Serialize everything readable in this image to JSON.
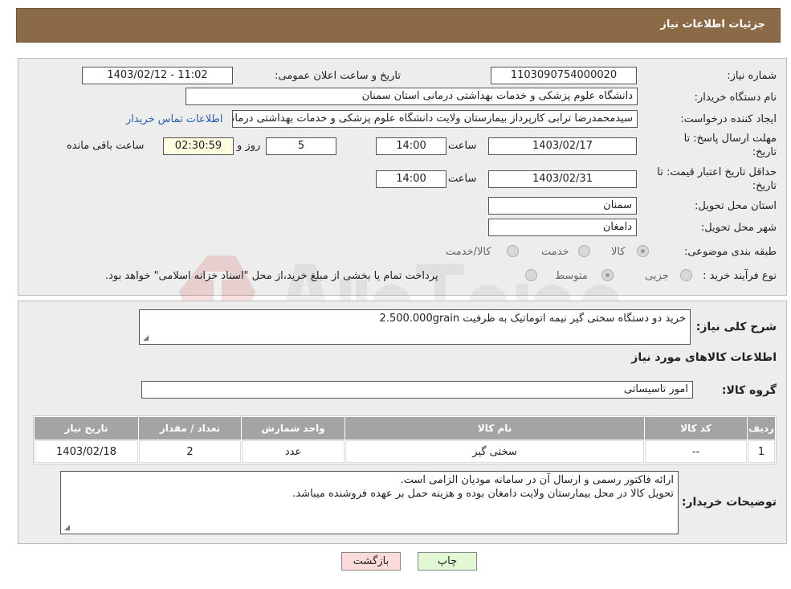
{
  "header": {
    "title": "جزئیات اطلاعات نیاز"
  },
  "form": {
    "need_number": {
      "label": "شماره نیاز:",
      "value": "1103090754000020"
    },
    "announce": {
      "label": "تاریخ و ساعت اعلان عمومی:",
      "value": "1403/02/12 - 11:02"
    },
    "buyer_org": {
      "label": "نام دستگاه خریدار:",
      "value": "دانشگاه علوم پزشکی و خدمات بهداشتی  درمانی استان سمنان"
    },
    "requester": {
      "label": "ایجاد کننده درخواست:",
      "value": "سیدمحمدرضا ترابی کارپرداز بیمارستان ولایت دانشگاه علوم پزشکی و خدمات بهداشتی درمانی",
      "contact_link": "اطلاعات تماس خریدار"
    },
    "reply_deadline": {
      "label_line1": "مهلت ارسال پاسخ: تا",
      "label_line2": "تاریخ:",
      "date": "1403/02/17",
      "time_label": "ساعت",
      "time": "14:00",
      "days": "5",
      "days_label": "روز و",
      "remaining": "02:30:59",
      "remaining_label": "ساعت باقی مانده"
    },
    "price_validity": {
      "label_line1": "حداقل تاریخ اعتبار قیمت: تا",
      "label_line2": "تاریخ:",
      "date": "1403/02/31",
      "time_label": "ساعت",
      "time": "14:00"
    },
    "province": {
      "label": "استان محل تحویل:",
      "value": "سمنان"
    },
    "city": {
      "label": "شهر محل تحویل:",
      "value": "دامغان"
    },
    "category": {
      "label": "طبقه بندی موضوعی:",
      "options": [
        "کالا",
        "خدمت",
        "کالا/خدمت"
      ]
    },
    "purchase_type": {
      "label": "نوع فرآیند خرید :",
      "options": [
        "جزیی",
        "متوسط"
      ],
      "note": "پرداخت تمام یا بخشی از مبلغ خرید،از محل \"اسناد خزانه اسلامی\" خواهد بود."
    }
  },
  "details": {
    "summary_label": "شرح کلی نیاز:",
    "summary": "خرید دو دستگاه سختی گیر نیمه اتوماتیک به ظرفیت 2.500.000grain",
    "goods_heading": "اطلاعات کالاهای مورد نیاز",
    "group_label": "گروه کالا:",
    "group_value": "امور تاسیساتی",
    "table": {
      "headers": [
        "ردیف",
        "کد کالا",
        "نام کالا",
        "واحد شمارش",
        "تعداد / مقدار",
        "تاریخ نیاز"
      ],
      "rows": [
        [
          "1",
          "--",
          "سختی گیر",
          "عدد",
          "2",
          "1403/02/18"
        ]
      ]
    },
    "buyer_notes_label": "توضیحات خریدار:",
    "buyer_notes_line1": "ارائه فاکتور رسمی و ارسال آن در سامانه مودیان الزامی است.",
    "buyer_notes_line2": "تحویل کالا در محل بیمارستان ولایت دامغان بوده و هزینه حمل بر عهده فروشنده میباشد."
  },
  "buttons": {
    "back": "بازگشت",
    "print": "چاپ"
  },
  "colors": {
    "header_bg": "#8b6a47",
    "link": "#2a5db0"
  }
}
